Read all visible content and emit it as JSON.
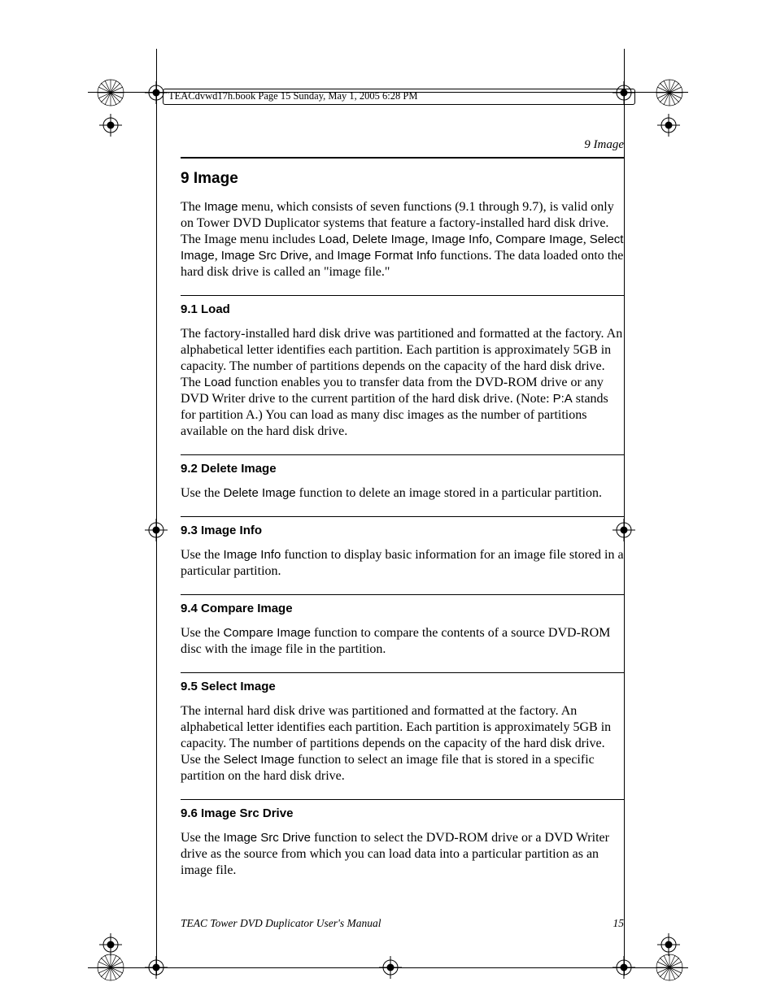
{
  "book_header": "TEACdvwd17h.book  Page 15  Sunday, May 1, 2005  6:28 PM",
  "running_head": "9 Image",
  "title": "9 Image",
  "intro_p1_a": "The ",
  "intro_p1_menu": "Image",
  "intro_p1_b": " menu, which consists of seven functions (9.1 through 9.7), is valid only on Tower DVD Duplicator systems that feature a factory-installed hard disk drive. The Image menu includes ",
  "intro_fn1": "Load",
  "intro_c1": ", ",
  "intro_fn2": "Delete Image",
  "intro_c2": ", ",
  "intro_fn3": "Image Info",
  "intro_c3": ", ",
  "intro_fn4": "Compare Image",
  "intro_c4": ", ",
  "intro_fn5": "Select Image",
  "intro_c5": ", ",
  "intro_fn6": "Image Src Drive",
  "intro_c6": ", and ",
  "intro_fn7": "Image Format Info",
  "intro_p1_c": " functions. The data loaded onto the hard disk drive is called an \"image file.\"",
  "s91_h": "9.1 Load",
  "s91_a": "The factory-installed hard disk drive was partitioned and formatted at the factory. An alphabetical letter identifies each partition. Each partition is approximately 5GB in capacity. The number of partitions depends on the capacity of the hard disk drive. The ",
  "s91_fn": "Load",
  "s91_b": " function enables you to transfer data from the DVD-ROM drive or any DVD Writer drive to the current partition of the hard disk drive. (Note: ",
  "s91_pa": "P:A",
  "s91_c": " stands for partition A.) You can load as many disc images as the number of partitions available on the hard disk drive.",
  "s92_h": "9.2 Delete Image",
  "s92_a": "Use the ",
  "s92_fn": "Delete Image",
  "s92_b": " function to delete an image stored in a particular partition.",
  "s93_h": "9.3 Image Info",
  "s93_a": "Use the ",
  "s93_fn": "Image Info",
  "s93_b": " function to display basic information for an image file stored in a particular partition.",
  "s94_h": "9.4 Compare Image",
  "s94_a": "Use the ",
  "s94_fn": "Compare Image",
  "s94_b": " function to compare the contents of a source DVD-ROM disc with the image file in the partition.",
  "s95_h": "9.5 Select Image",
  "s95_a": "The internal hard disk drive was partitioned and formatted at the factory. An alphabetical letter identifies each partition. Each partition is approximately 5GB in capacity. The number of partitions depends on the capacity of the hard disk drive. Use the ",
  "s95_fn": "Select Image",
  "s95_b": " function to select an image file that is stored in a specific partition on the hard disk drive.",
  "s96_h": "9.6 Image Src Drive",
  "s96_a": "Use the ",
  "s96_fn": "Image Src Drive",
  "s96_b": " function to select the DVD-ROM drive or a DVD Writer drive as the source from which you can load data into a particular partition as an image file.",
  "footer_title": "TEAC Tower DVD Duplicator User's Manual",
  "footer_page": "15"
}
